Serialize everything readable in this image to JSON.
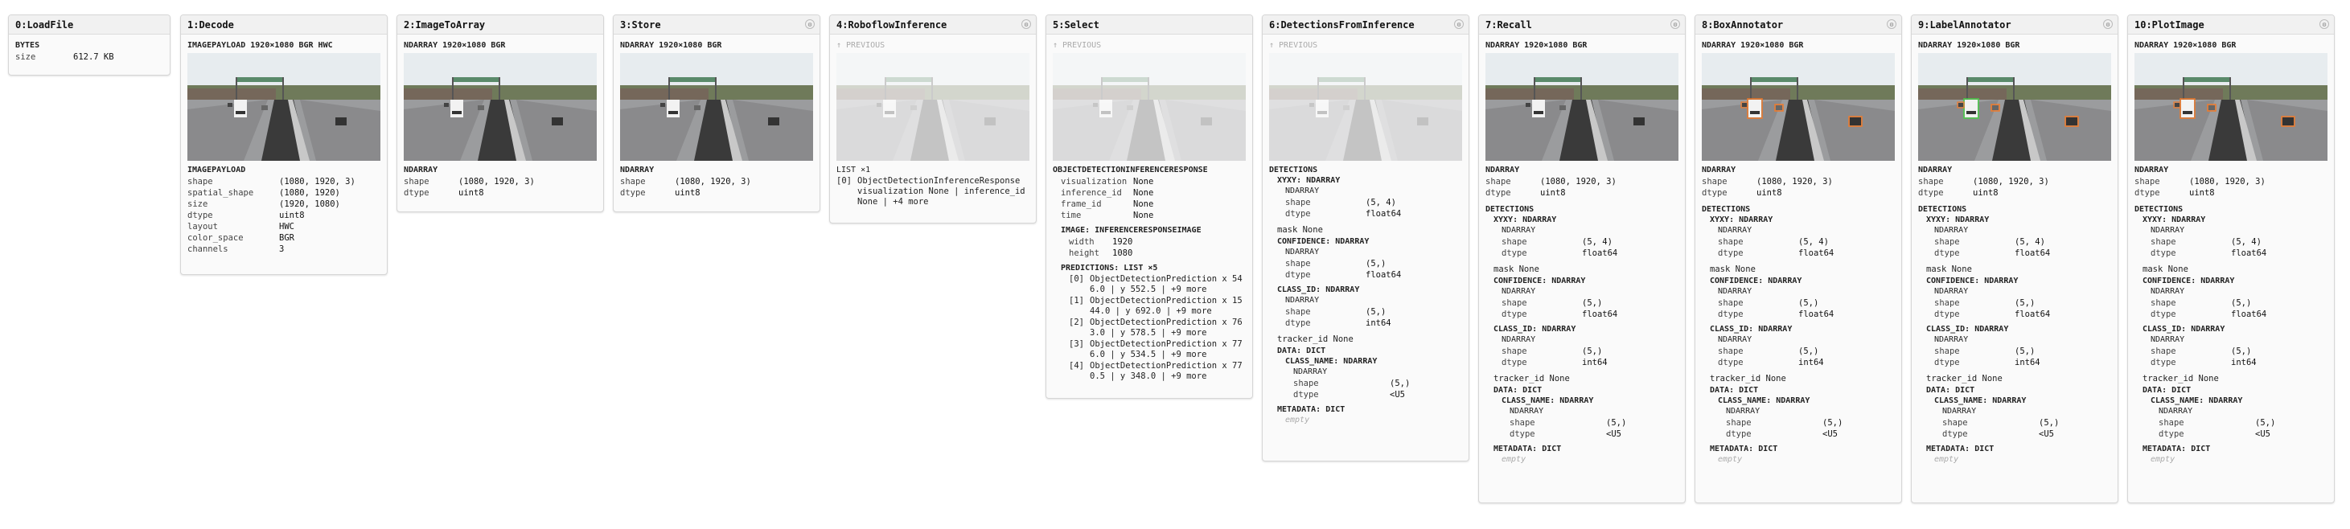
{
  "nodes": {
    "n0": {
      "title": "0:LoadFile",
      "type": "BYTES",
      "size_key": "size",
      "size_val": "612.7 KB"
    },
    "n1": {
      "title": "1:Decode",
      "header": "IMAGEPAYLOAD 1920×1080 BGR HWC",
      "section": "IMAGEPAYLOAD",
      "rows": [
        [
          "shape",
          "(1080, 1920, 3)"
        ],
        [
          "spatial_shape",
          "(1080, 1920)"
        ],
        [
          "size",
          "(1920, 1080)"
        ],
        [
          "dtype",
          "uint8"
        ],
        [
          "layout",
          "HWC"
        ],
        [
          "color_space",
          "BGR"
        ],
        [
          "channels",
          "3"
        ]
      ]
    },
    "n2": {
      "title": "2:ImageToArray",
      "header": "NDARRAY 1920×1080 BGR",
      "section": "NDARRAY",
      "rows": [
        [
          "shape",
          "(1080, 1920, 3)"
        ],
        [
          "dtype",
          "uint8"
        ]
      ]
    },
    "n3": {
      "title": "3:Store",
      "header": "NDARRAY 1920×1080 BGR",
      "section": "NDARRAY",
      "rows": [
        [
          "shape",
          "(1080, 1920, 3)"
        ],
        [
          "dtype",
          "uint8"
        ]
      ]
    },
    "n4": {
      "title": "4:RoboflowInference",
      "prev": "↑ PREVIOUS",
      "list": "LIST ×1",
      "item_idx": "[0]",
      "item": "ObjectDetectionInferenceResponse visualization None | inference_id None | +4 more"
    },
    "n5": {
      "title": "5:Select",
      "prev": "↑ PREVIOUS",
      "section": "OBJECTDETECTIONINFERENCERESPONSE",
      "rows": [
        [
          "visualization",
          "None"
        ],
        [
          "inference_id",
          "None"
        ],
        [
          "frame_id",
          "None"
        ],
        [
          "time",
          "None"
        ]
      ],
      "image_section": "IMAGE: INFERENCERESPONSEIMAGE",
      "image_rows": [
        [
          "width",
          "1920"
        ],
        [
          "height",
          "1080"
        ]
      ],
      "pred_section": "PREDICTIONS: LIST ×5",
      "preds": [
        [
          "[0]",
          "ObjectDetectionPrediction x 546.0 | y 552.5 | +9 more"
        ],
        [
          "[1]",
          "ObjectDetectionPrediction x 1544.0 | y 692.0 | +9 more"
        ],
        [
          "[2]",
          "ObjectDetectionPrediction x 763.0 | y 578.5 | +9 more"
        ],
        [
          "[3]",
          "ObjectDetectionPrediction x 776.0 | y 534.5 | +9 more"
        ],
        [
          "[4]",
          "ObjectDetectionPrediction x 770.5 | y 348.0 | +9 more"
        ]
      ]
    },
    "n6": {
      "title": "6:DetectionsFromInference",
      "prev": "↑ PREVIOUS"
    },
    "n7": {
      "title": "7:Recall",
      "header": "NDARRAY 1920×1080 BGR"
    },
    "n8": {
      "title": "8:BoxAnnotator",
      "header": "NDARRAY 1920×1080 BGR"
    },
    "n9": {
      "title": "9:LabelAnnotator",
      "header": "NDARRAY 1920×1080 BGR"
    },
    "n10": {
      "title": "10:PlotImage",
      "header": "NDARRAY 1920×1080 BGR"
    }
  },
  "common": {
    "ndarray": "NDARRAY",
    "shape": "shape",
    "dtype": "dtype",
    "shape3": "(1080, 1920, 3)",
    "uint8": "uint8"
  },
  "det": {
    "title": "DETECTIONS",
    "xyxy": "XYXY: NDARRAY",
    "nd": "NDARRAY",
    "shape_k": "shape",
    "dtype_k": "dtype",
    "xyxy_shape": "(5, 4)",
    "xyxy_dtype": "float64",
    "mask": "mask None",
    "conf": "CONFIDENCE: NDARRAY",
    "conf_shape": "(5,)",
    "conf_dtype": "float64",
    "cls": "CLASS_ID: NDARRAY",
    "cls_shape": "(5,)",
    "cls_dtype": "int64",
    "tracker": "tracker_id None",
    "data": "DATA: DICT",
    "cname": "CLASS_NAME: NDARRAY",
    "cname_shape": "(5,)",
    "cname_dtype": "<U5",
    "meta": "METADATA: DICT",
    "empty": "empty"
  },
  "colors": {
    "box_green": "#4ad04a",
    "box_orange": "#f07a2a",
    "sky": "#e7ecef",
    "road": "#8a8a8c"
  }
}
